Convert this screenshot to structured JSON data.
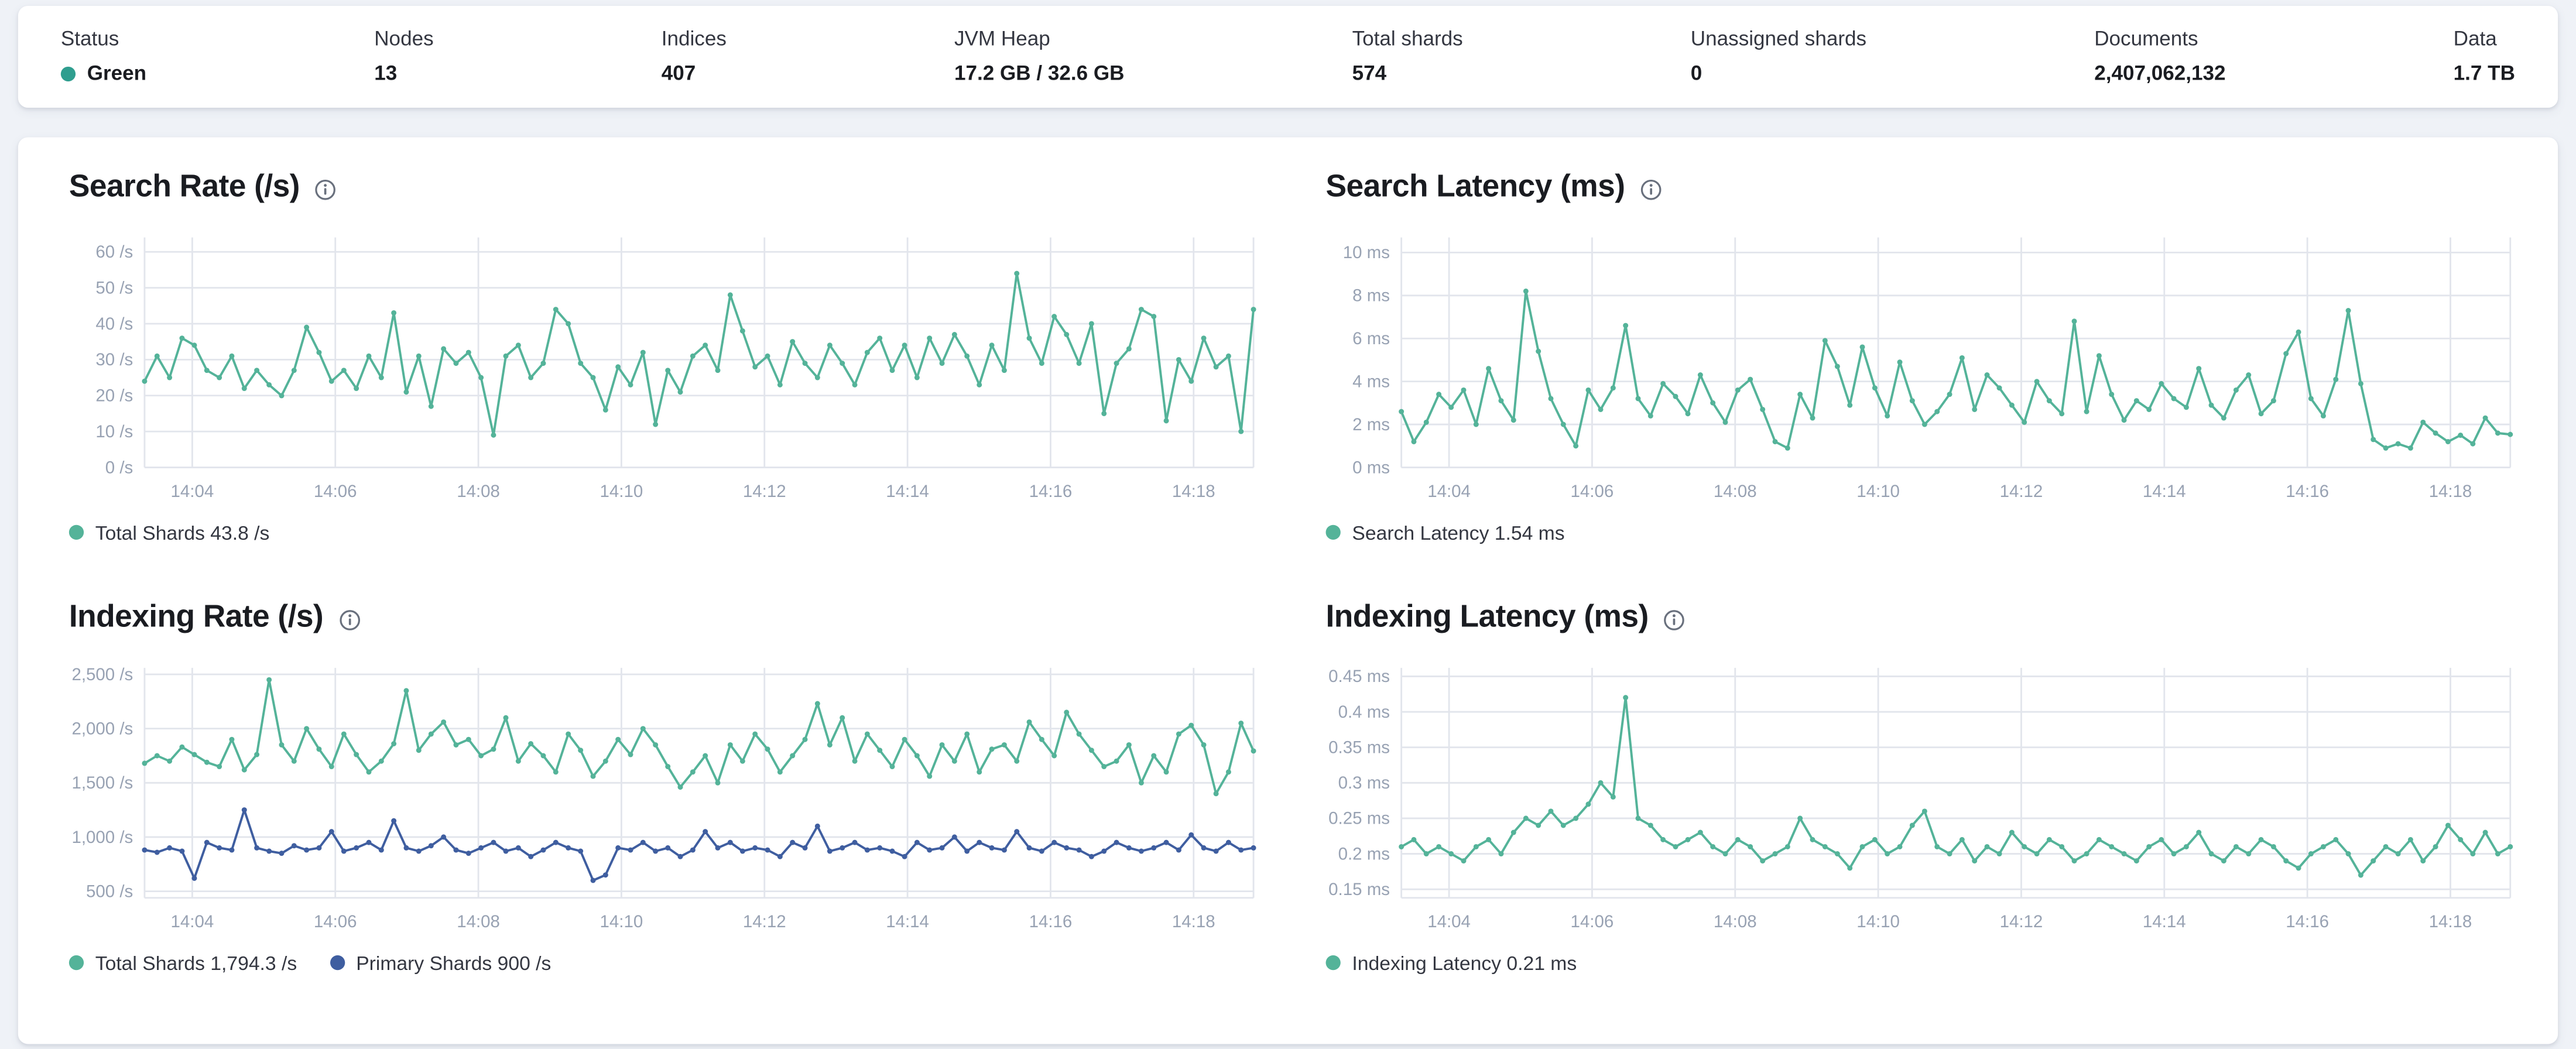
{
  "topbar": {
    "items": [
      {
        "label": "Status",
        "value": "Green",
        "type": "status"
      },
      {
        "label": "Nodes",
        "value": "13"
      },
      {
        "label": "Indices",
        "value": "407"
      },
      {
        "label": "JVM Heap",
        "value": "17.2 GB / 32.6 GB"
      },
      {
        "label": "Total shards",
        "value": "574"
      },
      {
        "label": "Unassigned shards",
        "value": "0"
      },
      {
        "label": "Documents",
        "value": "2,407,062,132"
      },
      {
        "label": "Data",
        "value": "1.7 TB"
      }
    ]
  },
  "colors": {
    "teal": "#54B399",
    "blue": "#3F5EA0",
    "status_green": "#2F9E8F",
    "grid": "#e2e5ec",
    "axis_text": "#98A2B3"
  },
  "chart_data": [
    {
      "type": "line",
      "title": "Search Rate (/s)",
      "ylabel": "/s",
      "ymin": 0,
      "ymax": 64,
      "y_ticks": [
        {
          "value": 0,
          "label": "0 /s"
        },
        {
          "value": 10,
          "label": "10 /s"
        },
        {
          "value": 20,
          "label": "20 /s"
        },
        {
          "value": 30,
          "label": "30 /s"
        },
        {
          "value": 40,
          "label": "40 /s"
        },
        {
          "value": 50,
          "label": "50 /s"
        },
        {
          "value": 60,
          "label": "60 /s"
        }
      ],
      "x_tick_labels": [
        "14:04",
        "14:06",
        "14:08",
        "14:10",
        "14:12",
        "14:14",
        "14:16",
        "14:18"
      ],
      "x_tick_fractions": [
        0.043,
        0.172,
        0.301,
        0.43,
        0.559,
        0.688,
        0.817,
        0.946
      ],
      "series": [
        {
          "name": "Total Shards",
          "color_key": "teal",
          "values": [
            24,
            31,
            25,
            36,
            34,
            27,
            25,
            31,
            22,
            27,
            23,
            20,
            27,
            39,
            32,
            24,
            27,
            22,
            31,
            25,
            43,
            21,
            31,
            17,
            33,
            29,
            32,
            25,
            9,
            31,
            34,
            25,
            29,
            44,
            40,
            29,
            25,
            16,
            28,
            23,
            32,
            12,
            27,
            21,
            31,
            34,
            27,
            48,
            38,
            28,
            31,
            23,
            35,
            29,
            25,
            34,
            29,
            23,
            32,
            36,
            27,
            34,
            25,
            36,
            29,
            37,
            31,
            23,
            34,
            27,
            54,
            36,
            29,
            42,
            37,
            29,
            40,
            15,
            29,
            33,
            44,
            42,
            13,
            30,
            24,
            36,
            28,
            31,
            10,
            44
          ]
        }
      ],
      "legend": [
        {
          "label": "Total Shards 43.8 /s",
          "color_key": "teal"
        }
      ]
    },
    {
      "type": "line",
      "title": "Search Latency (ms)",
      "ylabel": "ms",
      "ymin": 0,
      "ymax": 10.7,
      "y_ticks": [
        {
          "value": 0,
          "label": "0 ms"
        },
        {
          "value": 2,
          "label": "2 ms"
        },
        {
          "value": 4,
          "label": "4 ms"
        },
        {
          "value": 6,
          "label": "6 ms"
        },
        {
          "value": 8,
          "label": "8 ms"
        },
        {
          "value": 10,
          "label": "10 ms"
        }
      ],
      "x_tick_labels": [
        "14:04",
        "14:06",
        "14:08",
        "14:10",
        "14:12",
        "14:14",
        "14:16",
        "14:18"
      ],
      "x_tick_fractions": [
        0.043,
        0.172,
        0.301,
        0.43,
        0.559,
        0.688,
        0.817,
        0.946
      ],
      "series": [
        {
          "name": "Search Latency",
          "color_key": "teal",
          "values": [
            2.6,
            1.2,
            2.1,
            3.4,
            2.8,
            3.6,
            2.0,
            4.6,
            3.1,
            2.2,
            8.2,
            5.4,
            3.2,
            2.0,
            1.0,
            3.6,
            2.7,
            3.7,
            6.6,
            3.2,
            2.4,
            3.9,
            3.3,
            2.5,
            4.3,
            3.0,
            2.1,
            3.6,
            4.1,
            2.7,
            1.2,
            0.9,
            3.4,
            2.3,
            5.9,
            4.7,
            2.9,
            5.6,
            3.7,
            2.4,
            4.9,
            3.1,
            2.0,
            2.6,
            3.4,
            5.1,
            2.7,
            4.3,
            3.7,
            2.9,
            2.1,
            4.0,
            3.1,
            2.5,
            6.8,
            2.6,
            5.2,
            3.4,
            2.2,
            3.1,
            2.7,
            3.9,
            3.2,
            2.8,
            4.6,
            2.9,
            2.3,
            3.6,
            4.3,
            2.5,
            3.1,
            5.3,
            6.3,
            3.2,
            2.4,
            4.1,
            7.3,
            3.9,
            1.3,
            0.9,
            1.1,
            0.9,
            2.1,
            1.6,
            1.2,
            1.5,
            1.1,
            2.3,
            1.6,
            1.54
          ]
        }
      ],
      "legend": [
        {
          "label": "Search Latency 1.54 ms",
          "color_key": "teal"
        }
      ]
    },
    {
      "type": "line",
      "title": "Indexing Rate (/s)",
      "ylabel": "/s",
      "ymin": 440,
      "ymax": 2560,
      "y_ticks": [
        {
          "value": 500,
          "label": "500 /s"
        },
        {
          "value": 1000,
          "label": "1,000 /s"
        },
        {
          "value": 1500,
          "label": "1,500 /s"
        },
        {
          "value": 2000,
          "label": "2,000 /s"
        },
        {
          "value": 2500,
          "label": "2,500 /s"
        }
      ],
      "x_tick_labels": [
        "14:04",
        "14:06",
        "14:08",
        "14:10",
        "14:12",
        "14:14",
        "14:16",
        "14:18"
      ],
      "x_tick_fractions": [
        0.043,
        0.172,
        0.301,
        0.43,
        0.559,
        0.688,
        0.817,
        0.946
      ],
      "series": [
        {
          "name": "Total Shards",
          "color_key": "teal",
          "values": [
            1680,
            1750,
            1700,
            1830,
            1760,
            1690,
            1650,
            1900,
            1620,
            1760,
            2450,
            1850,
            1700,
            2000,
            1810,
            1650,
            1950,
            1760,
            1600,
            1700,
            1860,
            2350,
            1800,
            1950,
            2060,
            1850,
            1900,
            1750,
            1810,
            2100,
            1700,
            1860,
            1750,
            1600,
            1950,
            1800,
            1560,
            1700,
            1900,
            1760,
            2000,
            1850,
            1650,
            1460,
            1600,
            1750,
            1500,
            1850,
            1700,
            1950,
            1810,
            1600,
            1750,
            1900,
            2230,
            1850,
            2100,
            1700,
            1950,
            1800,
            1650,
            1900,
            1750,
            1560,
            1850,
            1700,
            1950,
            1600,
            1810,
            1850,
            1700,
            2060,
            1900,
            1750,
            2150,
            1950,
            1800,
            1650,
            1700,
            1850,
            1500,
            1750,
            1600,
            1950,
            2030,
            1850,
            1400,
            1600,
            2050,
            1794.3
          ]
        },
        {
          "name": "Primary Shards",
          "color_key": "blue",
          "values": [
            880,
            860,
            900,
            870,
            620,
            950,
            900,
            880,
            1250,
            900,
            870,
            850,
            920,
            880,
            900,
            1050,
            870,
            900,
            950,
            880,
            1150,
            900,
            870,
            920,
            1000,
            880,
            850,
            900,
            950,
            870,
            900,
            820,
            880,
            950,
            900,
            870,
            600,
            650,
            900,
            880,
            950,
            870,
            900,
            820,
            880,
            1050,
            900,
            950,
            870,
            900,
            880,
            820,
            950,
            900,
            1100,
            870,
            900,
            950,
            880,
            900,
            870,
            820,
            950,
            880,
            900,
            1000,
            870,
            950,
            900,
            880,
            1050,
            900,
            870,
            950,
            900,
            880,
            820,
            870,
            950,
            900,
            870,
            900,
            950,
            880,
            1020,
            900,
            870,
            950,
            880,
            900
          ]
        }
      ],
      "legend": [
        {
          "label": "Total Shards 1,794.3 /s",
          "color_key": "teal"
        },
        {
          "label": "Primary Shards 900 /s",
          "color_key": "blue"
        }
      ]
    },
    {
      "type": "line",
      "title": "Indexing Latency (ms)",
      "ylabel": "ms",
      "ymin": 0.138,
      "ymax": 0.462,
      "y_ticks": [
        {
          "value": 0.15,
          "label": "0.15 ms"
        },
        {
          "value": 0.2,
          "label": "0.2 ms"
        },
        {
          "value": 0.25,
          "label": "0.25 ms"
        },
        {
          "value": 0.3,
          "label": "0.3 ms"
        },
        {
          "value": 0.35,
          "label": "0.35 ms"
        },
        {
          "value": 0.4,
          "label": "0.4 ms"
        },
        {
          "value": 0.45,
          "label": "0.45 ms"
        }
      ],
      "x_tick_labels": [
        "14:04",
        "14:06",
        "14:08",
        "14:10",
        "14:12",
        "14:14",
        "14:16",
        "14:18"
      ],
      "x_tick_fractions": [
        0.043,
        0.172,
        0.301,
        0.43,
        0.559,
        0.688,
        0.817,
        0.946
      ],
      "series": [
        {
          "name": "Indexing Latency",
          "color_key": "teal",
          "values": [
            0.21,
            0.22,
            0.2,
            0.21,
            0.2,
            0.19,
            0.21,
            0.22,
            0.2,
            0.23,
            0.25,
            0.24,
            0.26,
            0.24,
            0.25,
            0.27,
            0.3,
            0.28,
            0.42,
            0.25,
            0.24,
            0.22,
            0.21,
            0.22,
            0.23,
            0.21,
            0.2,
            0.22,
            0.21,
            0.19,
            0.2,
            0.21,
            0.25,
            0.22,
            0.21,
            0.2,
            0.18,
            0.21,
            0.22,
            0.2,
            0.21,
            0.24,
            0.26,
            0.21,
            0.2,
            0.22,
            0.19,
            0.21,
            0.2,
            0.23,
            0.21,
            0.2,
            0.22,
            0.21,
            0.19,
            0.2,
            0.22,
            0.21,
            0.2,
            0.19,
            0.21,
            0.22,
            0.2,
            0.21,
            0.23,
            0.2,
            0.19,
            0.21,
            0.2,
            0.22,
            0.21,
            0.19,
            0.18,
            0.2,
            0.21,
            0.22,
            0.2,
            0.17,
            0.19,
            0.21,
            0.2,
            0.22,
            0.19,
            0.21,
            0.24,
            0.22,
            0.2,
            0.23,
            0.2,
            0.21
          ]
        }
      ],
      "legend": [
        {
          "label": "Indexing Latency 0.21 ms",
          "color_key": "teal"
        }
      ]
    }
  ]
}
